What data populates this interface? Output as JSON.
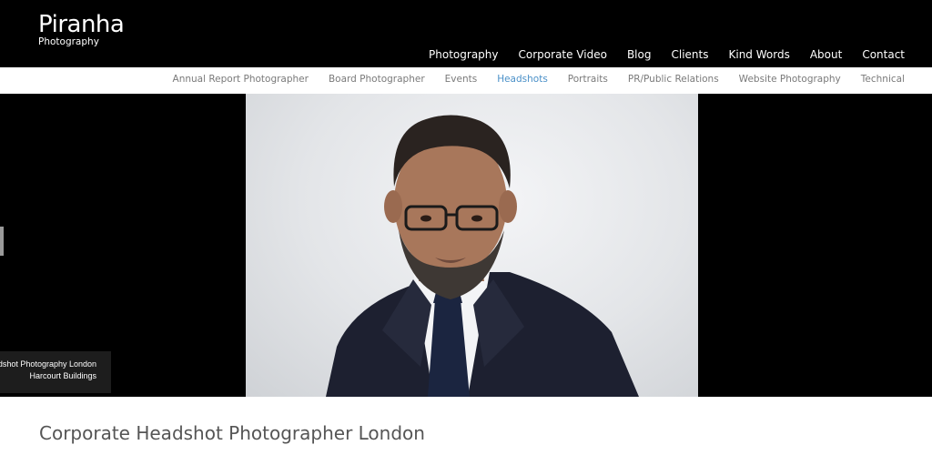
{
  "brand": {
    "name": "Piranha",
    "tagline": "Photography"
  },
  "main_nav": [
    {
      "label": "Photography"
    },
    {
      "label": "Corporate Video"
    },
    {
      "label": "Blog"
    },
    {
      "label": "Clients"
    },
    {
      "label": "Kind Words"
    },
    {
      "label": "About"
    },
    {
      "label": "Contact"
    }
  ],
  "sub_nav": [
    {
      "label": "Annual Report Photographer",
      "active": false
    },
    {
      "label": "Board Photographer",
      "active": false
    },
    {
      "label": "Events",
      "active": false
    },
    {
      "label": "Headshots",
      "active": true
    },
    {
      "label": "Portraits",
      "active": false
    },
    {
      "label": "PR/Public Relations",
      "active": false
    },
    {
      "label": "Website Photography",
      "active": false
    },
    {
      "label": "Technical",
      "active": false
    }
  ],
  "hero": {
    "caption_line1": "Corporate Headshot Photography London",
    "caption_line2": "Harcourt Buildings"
  },
  "page": {
    "title": "Corporate Headshot Photographer London"
  },
  "colors": {
    "header_bg": "#000000",
    "active_link": "#4a90c8",
    "subnav_text": "#7a7a7a"
  }
}
